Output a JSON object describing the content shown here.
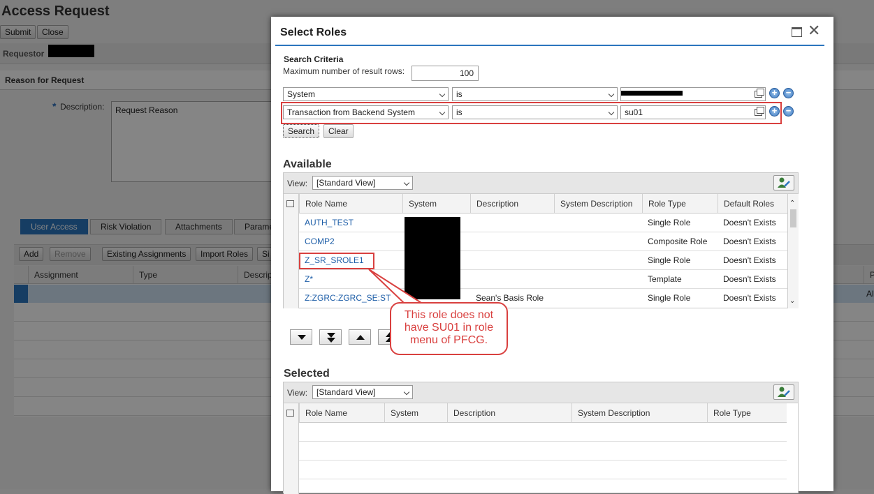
{
  "page": {
    "title": "Access Request",
    "buttons": {
      "submit": "Submit",
      "close": "Close"
    },
    "requestor_label": "Requestor",
    "reason_section": "Reason for Request",
    "description_label": "Description:",
    "description_value": "Request Reason",
    "tabs": [
      "User Access",
      "Risk Violation",
      "Attachments",
      "Parame"
    ],
    "toolbar": {
      "add": "Add",
      "remove": "Remove",
      "existing": "Existing Assignments",
      "import": "Import Roles",
      "more": "Si"
    },
    "columns": [
      "Assignment",
      "Type",
      "Descrip",
      "P"
    ],
    "right_cell": "Al"
  },
  "dialog": {
    "title": "Select Roles",
    "search_criteria_label": "Search Criteria",
    "max_rows_label": "Maximum number of result rows:",
    "max_rows_value": "100",
    "criteria": [
      {
        "field": "System",
        "operator": "is",
        "value": ""
      },
      {
        "field": "Transaction from Backend System",
        "operator": "is",
        "value": "su01"
      }
    ],
    "search_button": "Search",
    "clear_button": "Clear",
    "available": {
      "title": "Available",
      "view_label": "View:",
      "view_value": "[Standard View]",
      "columns": [
        "Role Name",
        "System",
        "Description",
        "System Description",
        "Role Type",
        "Default Roles"
      ],
      "rows": [
        {
          "role": "AUTH_TEST",
          "system": "",
          "description": "",
          "sys_desc": "",
          "type": "Single Role",
          "default": "Doesn't Exists"
        },
        {
          "role": "COMP2",
          "system": "",
          "description": "",
          "sys_desc": "",
          "type": "Composite Role",
          "default": "Doesn't Exists"
        },
        {
          "role": "Z_SR_SROLE1",
          "system": "",
          "description": "",
          "sys_desc": "",
          "type": "Single Role",
          "default": "Doesn't Exists"
        },
        {
          "role": "Z*",
          "system": "",
          "description": "",
          "sys_desc": "",
          "type": "Template",
          "default": "Doesn't Exists"
        },
        {
          "role": "Z:ZGRC:ZGRC_SE:ST",
          "system": "",
          "description": "Sean's Basis Role",
          "sys_desc": "",
          "type": "Single Role",
          "default": "Doesn't Exists"
        }
      ]
    },
    "callout": "This role does not have SU01 in role menu of PFCG.",
    "selected": {
      "title": "Selected",
      "view_label": "View:",
      "view_value": "[Standard View]",
      "columns": [
        "Role Name",
        "System",
        "Description",
        "System Description",
        "Role Type"
      ]
    }
  },
  "colors": {
    "accent": "#2b75be",
    "highlight": "#d9403f",
    "link": "#1f5fa8"
  }
}
